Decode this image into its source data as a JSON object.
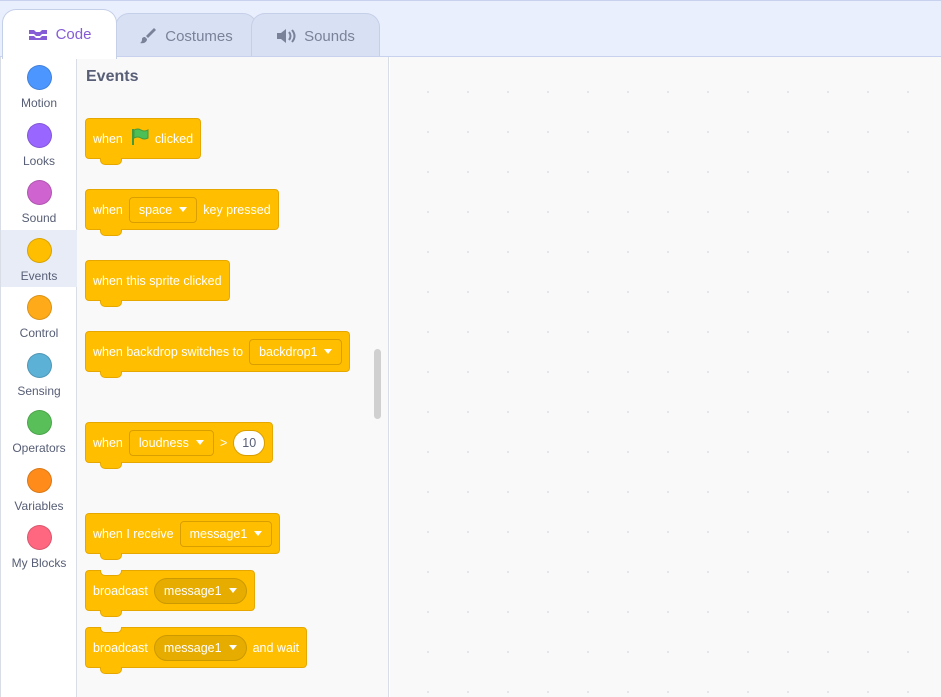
{
  "tabs": {
    "code": "Code",
    "costumes": "Costumes",
    "sounds": "Sounds"
  },
  "categories": [
    {
      "label": "Motion",
      "color": "#4c97ff"
    },
    {
      "label": "Looks",
      "color": "#9966ff"
    },
    {
      "label": "Sound",
      "color": "#cf63cf"
    },
    {
      "label": "Events",
      "color": "#ffbf00"
    },
    {
      "label": "Control",
      "color": "#ffab19"
    },
    {
      "label": "Sensing",
      "color": "#5cb1d6"
    },
    {
      "label": "Operators",
      "color": "#59c059"
    },
    {
      "label": "Variables",
      "color": "#ff8c1a"
    },
    {
      "label": "My Blocks",
      "color": "#ff6680"
    }
  ],
  "palette": {
    "title": "Events",
    "blocks": {
      "flag": {
        "pre": "when",
        "post": "clicked"
      },
      "key": {
        "pre": "when",
        "menu": "space",
        "post": "key pressed"
      },
      "sprite": {
        "text": "when this sprite clicked"
      },
      "backdrop": {
        "pre": "when backdrop switches to",
        "menu": "backdrop1"
      },
      "loudness": {
        "pre": "when",
        "menu": "loudness",
        "op": ">",
        "value": "10"
      },
      "receive": {
        "pre": "when I receive",
        "menu": "message1"
      },
      "broadcast": {
        "pre": "broadcast",
        "menu": "message1"
      },
      "broadcast_wait": {
        "pre": "broadcast",
        "menu": "message1",
        "post": "and wait"
      }
    }
  },
  "colors": {
    "events": "#ffbf00",
    "accent": "#855cd6"
  }
}
